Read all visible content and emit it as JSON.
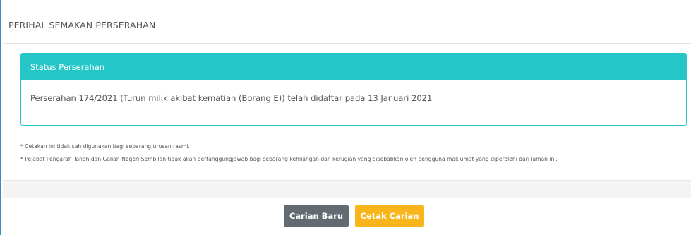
{
  "panel": {
    "title": "PERIHAL SEMAKAN PERSERAHAN"
  },
  "status": {
    "header": "Status Perserahan",
    "message": "Perserahan 174/2021 (Turun milik akibat kematian (Borang E)) telah didaftar pada 13 Januari 2021"
  },
  "notes": [
    "* Cetakan ini tidak sah digunakan bagi sebarang urusan rasmi.",
    "* Pejabat Pengarah Tanah dan Galian Negeri Sembilan tidak akan bertanggungjawab bagi sebarang kehilangan dan kerugian yang disebabkan oleh pengguna maklumat yang diperolehi dari laman ini."
  ],
  "actions": {
    "new_search_label": "Carian Baru",
    "print_search_label": "Cetak Carian"
  },
  "colors": {
    "accent": "#25c6c8",
    "frame_border": "#3c8dbc",
    "button_gray": "#636a72",
    "button_yellow": "#f8b61c"
  }
}
